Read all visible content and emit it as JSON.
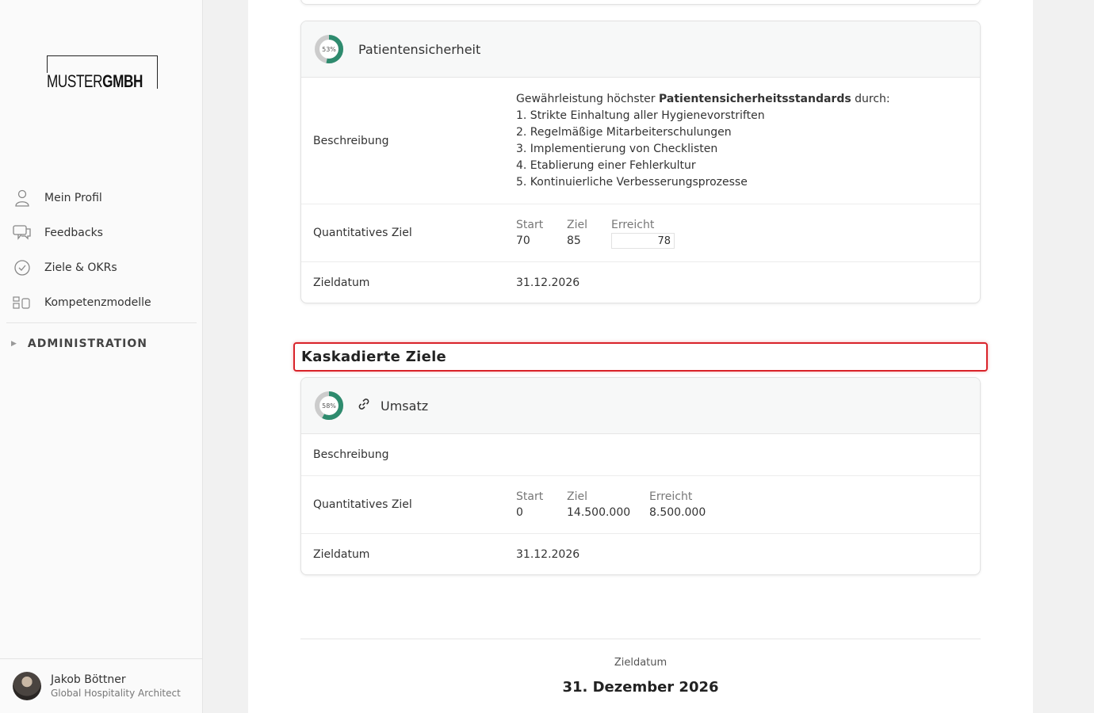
{
  "brand": {
    "logo_regular": "MUSTER",
    "logo_bold": "GMBH"
  },
  "sidebar": {
    "items": [
      {
        "label": "Mein Profil",
        "icon": "user-icon"
      },
      {
        "label": "Feedbacks",
        "icon": "chat-icon"
      },
      {
        "label": "Ziele & OKRs",
        "icon": "check-circle-icon"
      },
      {
        "label": "Kompetenzmodelle",
        "icon": "blocks-icon"
      }
    ],
    "admin": {
      "label": "ADMINISTRATION",
      "icon": "caret-right-icon"
    }
  },
  "user": {
    "name": "Jakob Böttner",
    "role": "Global Hospitality Architect"
  },
  "colors": {
    "progress": "#2e8b6e",
    "progress_track": "#cccccc",
    "highlight": "#d9232a"
  },
  "goal1": {
    "percent_label": "53%",
    "progress": 0.53,
    "title": "Patientensicherheit",
    "description_label": "Beschreibung",
    "desc_intro_pre": "Gewährleistung höchster ",
    "desc_intro_bold": "Patientensicherheitsstandards",
    "desc_intro_post": " durch:",
    "desc_items": [
      "1. Strikte Einhaltung aller Hygienevorstriften",
      "2. Regelmäßige Mitarbeiterschulungen",
      "3. Implementierung von Checklisten",
      "4. Etablierung einer Fehlerkultur",
      "5. Kontinuierliche Verbesserungsprozesse"
    ],
    "quant_label": "Quantitatives Ziel",
    "start_label": "Start",
    "start_value": "70",
    "ziel_label": "Ziel",
    "ziel_value": "85",
    "erreicht_label": "Erreicht",
    "erreicht_value": "78",
    "date_label": "Zieldatum",
    "date_value": "31.12.2026"
  },
  "section": {
    "title": "Kaskadierte Ziele"
  },
  "goal2": {
    "percent_label": "58%",
    "progress": 0.58,
    "title": "Umsatz",
    "description_label": "Beschreibung",
    "quant_label": "Quantitatives Ziel",
    "start_label": "Start",
    "start_value": "0",
    "ziel_label": "Ziel",
    "ziel_value": "14.500.000",
    "erreicht_label": "Erreicht",
    "erreicht_value": "8.500.000",
    "date_label": "Zieldatum",
    "date_value": "31.12.2026"
  },
  "footer": {
    "label": "Zieldatum",
    "date": "31. Dezember 2026"
  }
}
